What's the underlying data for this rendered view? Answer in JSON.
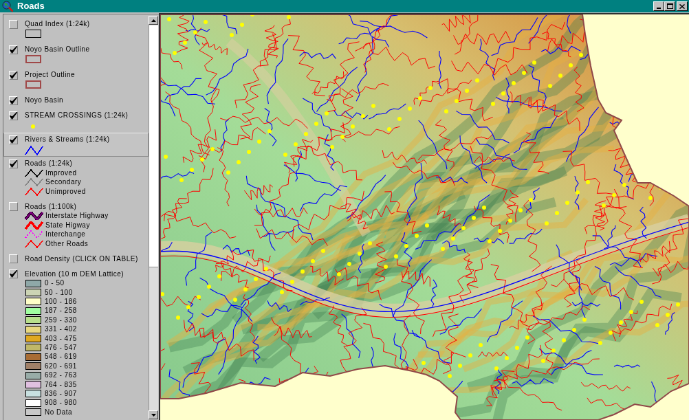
{
  "window": {
    "title": "Roads"
  },
  "legend": {
    "layers": [
      {
        "name": "Quad Index (1:24k)",
        "checked": false,
        "selected": false,
        "symbol": {
          "kind": "outline",
          "color": "#000000"
        }
      },
      {
        "name": "Noyo Basin Outline",
        "checked": true,
        "selected": false,
        "symbol": {
          "kind": "thick-outline",
          "color": "#a04848"
        }
      },
      {
        "name": "Project Outline",
        "checked": true,
        "selected": false,
        "symbol": {
          "kind": "thick-outline",
          "color": "#a04848"
        }
      },
      {
        "name": "Noyo Basin",
        "checked": true,
        "selected": false
      },
      {
        "name": "STREAM CROSSINGS (1:24k)",
        "checked": true,
        "selected": false,
        "symbol": {
          "kind": "dot",
          "color": "#ffff00"
        }
      },
      {
        "name": "Rivers & Streams (1:24k)",
        "checked": true,
        "selected": true,
        "symbol": {
          "kind": "line",
          "color": "#0000ff"
        }
      },
      {
        "name": "Roads (1:24k)",
        "checked": true,
        "selected": false,
        "classes": [
          {
            "label": "Improved",
            "kind": "line",
            "color": "#000000"
          },
          {
            "label": "Secondary",
            "kind": "line",
            "color": "#808080"
          },
          {
            "label": "Unimproved",
            "kind": "line",
            "color": "#ff0000"
          }
        ]
      },
      {
        "name": "Roads (1:100k)",
        "checked": false,
        "selected": false,
        "classes": [
          {
            "label": "Interstate Highway",
            "kind": "double",
            "color": "#800080"
          },
          {
            "label": "State Higway",
            "kind": "thick",
            "color": "#ff0000"
          },
          {
            "label": "Interchange",
            "kind": "dotted",
            "color": "#ff00ff"
          },
          {
            "label": "Other Roads",
            "kind": "line",
            "color": "#ff0000"
          }
        ]
      },
      {
        "name": "Road Density (CLICK ON TABLE)",
        "checked": false,
        "selected": false
      },
      {
        "name": "Elevation (10 m DEM Lattice)",
        "checked": true,
        "selected": false,
        "classes": [
          {
            "label": "0 - 50",
            "color": "#8fa8a8"
          },
          {
            "label": "50 - 100",
            "color": "#ccd4b4"
          },
          {
            "label": "100 - 186",
            "color": "#ffffc8"
          },
          {
            "label": "187 - 258",
            "color": "#a0ffa0"
          },
          {
            "label": "259 - 330",
            "color": "#b8e08c"
          },
          {
            "label": "331 - 402",
            "color": "#e8d880"
          },
          {
            "label": "403 - 475",
            "color": "#e0a820"
          },
          {
            "label": "476 - 547",
            "color": "#c0b868"
          },
          {
            "label": "548 - 619",
            "color": "#a86c34"
          },
          {
            "label": "620 - 691",
            "color": "#a08068"
          },
          {
            "label": "692 - 763",
            "color": "#98aca8"
          },
          {
            "label": "764 - 835",
            "color": "#e0c0e0"
          },
          {
            "label": "836 - 907",
            "color": "#c8e0e0"
          },
          {
            "label": "908 - 980",
            "color": "#ffffff"
          },
          {
            "label": "No Data",
            "color": "#c8c8c8"
          }
        ]
      }
    ]
  }
}
